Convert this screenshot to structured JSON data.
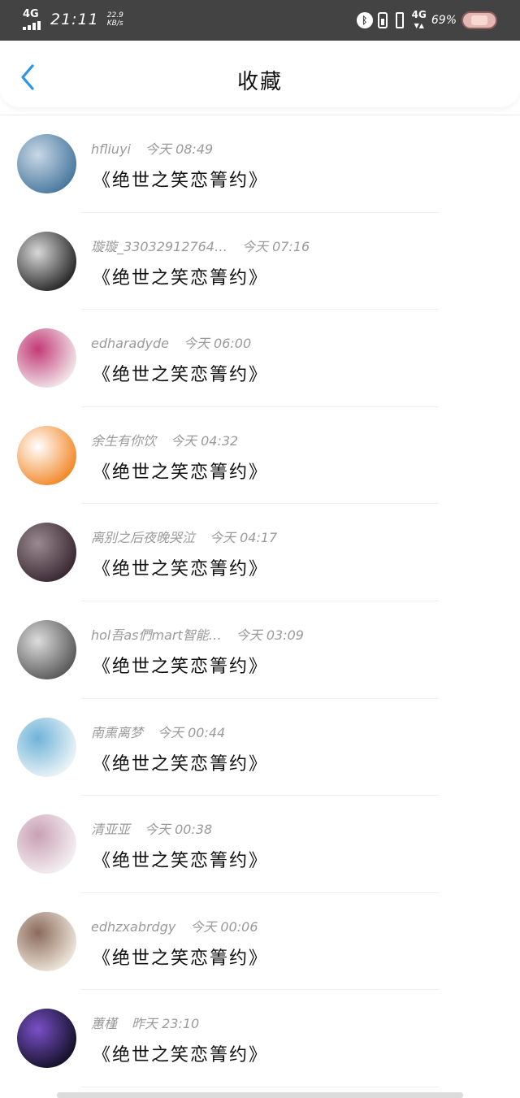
{
  "status_bar": {
    "network": "4G",
    "time": "21:11",
    "speed_value": "22.9",
    "speed_unit": "KB/s",
    "network_right": "4G",
    "battery_percent": "69%"
  },
  "header": {
    "title": "收藏"
  },
  "favorites": [
    {
      "user": "hfliuyi",
      "time": "今天 08:49",
      "content": "《绝世之笑恋箐约》"
    },
    {
      "user": "璇璇_33032912764…",
      "time": "今天 07:16",
      "content": "《绝世之笑恋箐约》"
    },
    {
      "user": "edharadyde",
      "time": "今天 06:00",
      "content": "《绝世之笑恋箐约》"
    },
    {
      "user": "余生有你饮",
      "time": "今天 04:32",
      "content": "《绝世之笑恋箐约》"
    },
    {
      "user": "离别之后夜晚哭泣",
      "time": "今天 04:17",
      "content": "《绝世之笑恋箐约》"
    },
    {
      "user": "hol吾as們mart智能…",
      "time": "今天 03:09",
      "content": "《绝世之笑恋箐约》"
    },
    {
      "user": "南熏离梦",
      "time": "今天 00:44",
      "content": "《绝世之笑恋箐约》"
    },
    {
      "user": "清亚亚",
      "time": "今天 00:38",
      "content": "《绝世之笑恋箐约》"
    },
    {
      "user": "edhzxabrdgy",
      "time": "今天 00:06",
      "content": "《绝世之笑恋箐约》"
    },
    {
      "user": "蕙槿",
      "time": "昨天 23:10",
      "content": "《绝世之笑恋箐约》"
    }
  ],
  "avatar_colors": [
    [
      "#4b7aa0",
      "#c9d8e6"
    ],
    [
      "#2b2b2b",
      "#d8d8d8"
    ],
    [
      "#f1e3e6",
      "#c23a78"
    ],
    [
      "#f28b2e",
      "#ffffff"
    ],
    [
      "#3b2a33",
      "#9a8a90"
    ],
    [
      "#5b5b5b",
      "#dddddd"
    ],
    [
      "#e9f3f7",
      "#6fb3d8"
    ],
    [
      "#f3eef0",
      "#c9a0b4"
    ],
    [
      "#ece3d8",
      "#8b6b5b"
    ],
    [
      "#15122b",
      "#7a50c8"
    ]
  ]
}
